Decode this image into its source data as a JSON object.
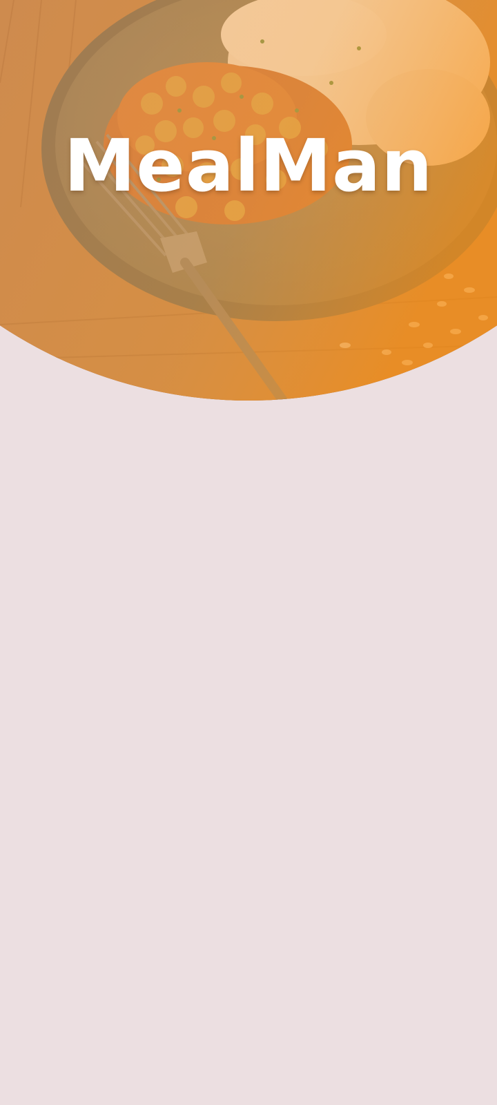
{
  "app": {
    "name": "MealMan"
  },
  "hero": {
    "image_icon": "food-plate-photo",
    "overlay_color": "#f4a13a"
  },
  "colors": {
    "background": "#ecdfe1",
    "title": "#ffffff"
  }
}
